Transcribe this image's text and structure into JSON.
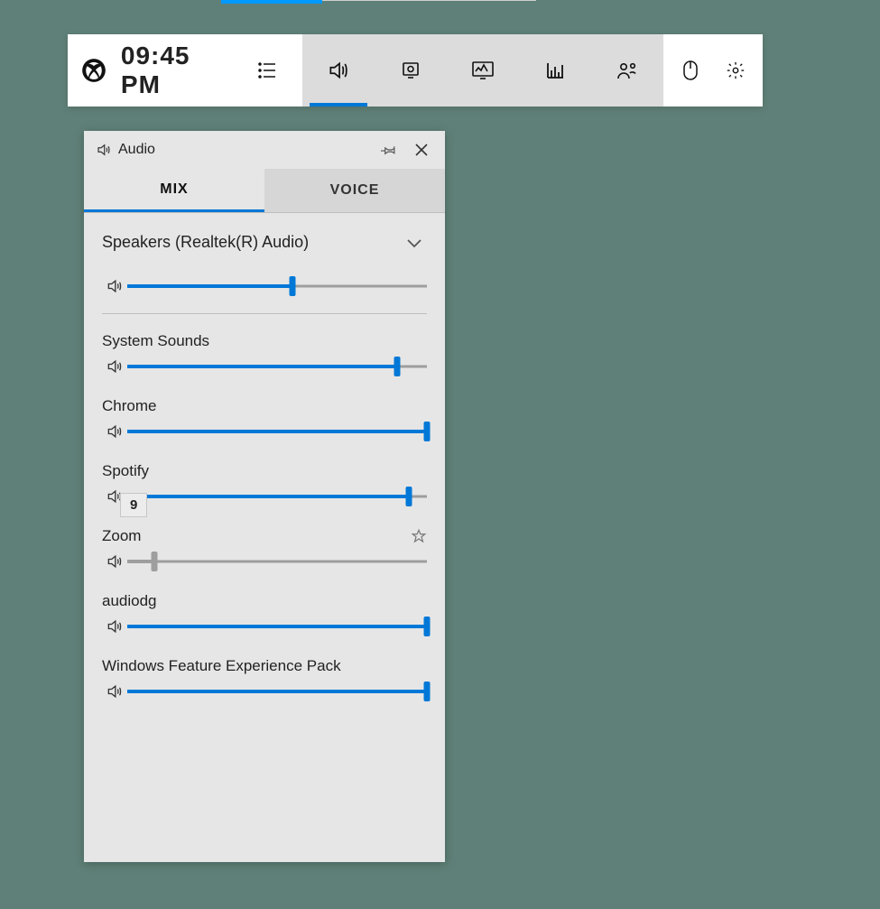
{
  "topbar": {
    "time": "09:45 PM"
  },
  "panel": {
    "title": "Audio",
    "tabs": {
      "mix": "MIX",
      "voice": "VOICE",
      "active": "mix"
    },
    "device": {
      "name": "Speakers (Realtek(R) Audio)",
      "volume": 55
    },
    "tooltip_value": "9",
    "apps": [
      {
        "name": "System Sounds",
        "volume": 90,
        "muted": false,
        "star": false
      },
      {
        "name": "Chrome",
        "volume": 100,
        "muted": false,
        "star": false
      },
      {
        "name": "Spotify",
        "volume": 94,
        "muted": false,
        "star": false
      },
      {
        "name": "Zoom",
        "volume": 9,
        "muted": true,
        "star": true
      },
      {
        "name": "audiodg",
        "volume": 100,
        "muted": false,
        "star": false
      },
      {
        "name": "Windows Feature Experience Pack",
        "volume": 100,
        "muted": false,
        "star": false
      }
    ]
  },
  "colors": {
    "accent": "#0078d7"
  }
}
